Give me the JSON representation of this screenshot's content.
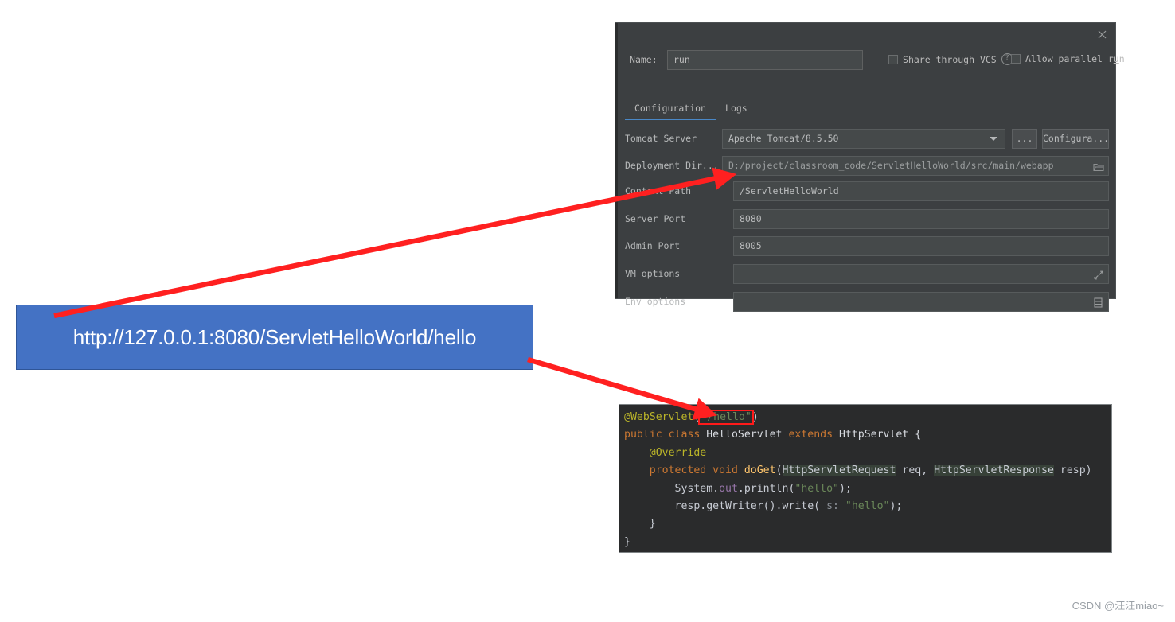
{
  "dialog": {
    "close_icon": "close-icon",
    "name_label": "Name:",
    "name_label_mnemonic": "N",
    "name_label_rest": "ame:",
    "name_value": "run",
    "share_vcs_label_mnemonic": "S",
    "share_vcs_label_rest": "hare through VCS",
    "help_icon": "?",
    "allow_parallel_prefix": "Allow parallel r",
    "allow_parallel_mnemonic": "u",
    "allow_parallel_suffix": "n",
    "tabs": [
      {
        "label": "Configuration",
        "active": true
      },
      {
        "label": "Logs",
        "active": false
      }
    ],
    "fields": [
      {
        "label": "Tomcat Server",
        "value": "Apache Tomcat/8.5.50"
      },
      {
        "label": "Deployment Dir...",
        "value": "D:/project/classroom_code/ServletHelloWorld/src/main/webapp"
      },
      {
        "label": "Context Path",
        "value": "/ServletHelloWorld"
      },
      {
        "label": "Server Port",
        "value": "8080"
      },
      {
        "label": "Admin Port",
        "value": "8005"
      },
      {
        "label": "VM options",
        "value": ""
      },
      {
        "label": "Env options",
        "value": ""
      }
    ],
    "buttons": {
      "ellipsis_label": "...",
      "configure_label": "Configura..."
    },
    "icons": {
      "dropdown": "chevron-down-icon",
      "folder": "folder-icon",
      "expand": "expand-icon",
      "list": "list-edit-icon"
    }
  },
  "callout": {
    "url": "http://127.0.0.1:8080/ServletHelloWorld/hello",
    "bg_color": "#4472C4",
    "text_color": "#FFFFFF"
  },
  "code": {
    "highlight_color": "#FF1A1A",
    "lines": [
      {
        "id": "line-webservlet",
        "segments": [
          {
            "t": "@WebServlet",
            "c": "tok-ann"
          },
          {
            "t": "(",
            "c": "tok-plain"
          },
          {
            "t": "\"/hello\"",
            "c": "tok-str",
            "highlight": true
          },
          {
            "t": ")",
            "c": "tok-plain"
          }
        ]
      },
      {
        "id": "line-class-decl",
        "segments": [
          {
            "t": "public class ",
            "c": "tok-kw"
          },
          {
            "t": "HelloServlet ",
            "c": "tok-cls"
          },
          {
            "t": "extends ",
            "c": "tok-kw"
          },
          {
            "t": "HttpServlet {",
            "c": "tok-cls"
          }
        ]
      },
      {
        "id": "line-override",
        "segments": [
          {
            "t": "    @Override",
            "c": "tok-ann"
          }
        ]
      },
      {
        "id": "line-doget",
        "segments": [
          {
            "t": "    protected void ",
            "c": "tok-kw"
          },
          {
            "t": "doGet",
            "c": "tok-mth"
          },
          {
            "t": "(",
            "c": "tok-plain"
          },
          {
            "t": "HttpServletRequest",
            "c": "tok-param"
          },
          {
            "t": " req, ",
            "c": "tok-plain"
          },
          {
            "t": "HttpServletResponse",
            "c": "tok-param"
          },
          {
            "t": " resp)",
            "c": "tok-plain"
          }
        ]
      },
      {
        "id": "line-println",
        "segments": [
          {
            "t": "        System.",
            "c": "tok-plain"
          },
          {
            "t": "out",
            "c": "tok-fld"
          },
          {
            "t": ".println(",
            "c": "tok-plain"
          },
          {
            "t": "\"hello\"",
            "c": "tok-str"
          },
          {
            "t": ");",
            "c": "tok-plain"
          }
        ]
      },
      {
        "id": "line-write",
        "segments": [
          {
            "t": "        resp.getWriter().write(",
            "c": "tok-plain"
          },
          {
            "t": " s:",
            "c": "tok-hint"
          },
          {
            "t": " ",
            "c": "tok-plain"
          },
          {
            "t": "\"hello\"",
            "c": "tok-str"
          },
          {
            "t": ");",
            "c": "tok-plain"
          }
        ]
      },
      {
        "id": "line-close-method",
        "segments": [
          {
            "t": "    }",
            "c": "tok-plain"
          }
        ]
      },
      {
        "id": "line-close-class",
        "segments": [
          {
            "t": "}",
            "c": "tok-plain"
          }
        ]
      }
    ]
  },
  "annotations": {
    "arrow_color": "#FF2020",
    "arrow_to_context_path": "arrow-callout-to-context-path",
    "arrow_to_code": "arrow-callout-to-webservlet"
  },
  "watermark": {
    "text": "CSDN @汪汪miao~"
  }
}
